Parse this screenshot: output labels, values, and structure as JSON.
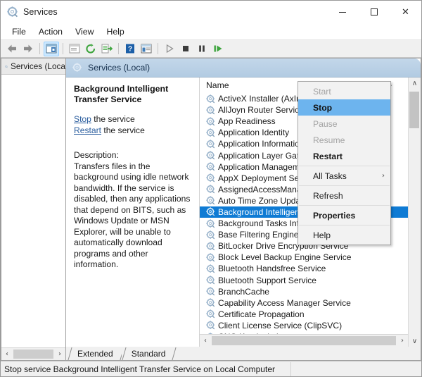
{
  "window": {
    "title": "Services",
    "icon": "services-gear-icon",
    "controls": {
      "minimize": "–",
      "maximize": "□",
      "close": "✕"
    }
  },
  "menubar": {
    "items": [
      "File",
      "Action",
      "View",
      "Help"
    ]
  },
  "toolbar": {
    "buttons": [
      {
        "name": "back-icon",
        "glyph": "back"
      },
      {
        "name": "forward-icon",
        "glyph": "forward"
      },
      {
        "name": "separator",
        "glyph": "sep"
      },
      {
        "name": "show-hide-console-tree-icon",
        "glyph": "tree",
        "active": true
      },
      {
        "name": "separator",
        "glyph": "sep"
      },
      {
        "name": "show-hide-action-pane-icon",
        "glyph": "pane"
      },
      {
        "name": "refresh-icon",
        "glyph": "refresh"
      },
      {
        "name": "export-list-icon",
        "glyph": "export"
      },
      {
        "name": "separator",
        "glyph": "sep"
      },
      {
        "name": "help-icon",
        "glyph": "help"
      },
      {
        "name": "show-hide-details-icon",
        "glyph": "details"
      },
      {
        "name": "separator",
        "glyph": "sep"
      },
      {
        "name": "start-service-icon",
        "glyph": "play"
      },
      {
        "name": "stop-service-icon",
        "glyph": "stop"
      },
      {
        "name": "pause-service-icon",
        "glyph": "pause"
      },
      {
        "name": "restart-service-icon",
        "glyph": "restart"
      }
    ]
  },
  "tree_pane": {
    "root_label": "Services (Loca"
  },
  "content_header": {
    "label": "Services (Local)"
  },
  "detail": {
    "service_title": "Background Intelligent Transfer Service",
    "stop_link": "Stop",
    "stop_suffix": " the service",
    "restart_link": "Restart",
    "restart_suffix": " the service",
    "description_label": "Description:",
    "description": "Transfers files in the background using idle network bandwidth. If the service is disabled, then any applications that depend on BITS, such as Windows Update or MSN Explorer, will be unable to automatically download programs and other information."
  },
  "list": {
    "column_header": "Name",
    "sort_indicator": "∧",
    "rows": [
      {
        "label": "ActiveX Installer (AxInstSV)",
        "selected": false
      },
      {
        "label": "AllJoyn Router Service",
        "selected": false
      },
      {
        "label": "App Readiness",
        "selected": false
      },
      {
        "label": "Application Identity",
        "selected": false
      },
      {
        "label": "Application Information",
        "selected": false
      },
      {
        "label": "Application Layer Gateway Service",
        "selected": false
      },
      {
        "label": "Application Management",
        "selected": false
      },
      {
        "label": "AppX Deployment Service (AppXSVC)",
        "selected": false
      },
      {
        "label": "AssignedAccessManager Service",
        "selected": false
      },
      {
        "label": "Auto Time Zone Updater",
        "selected": false
      },
      {
        "label": "Background Intelligent Transfer Service",
        "selected": true
      },
      {
        "label": "Background Tasks Infrastructure Service",
        "selected": false
      },
      {
        "label": "Base Filtering Engine",
        "selected": false
      },
      {
        "label": "BitLocker Drive Encryption Service",
        "selected": false
      },
      {
        "label": "Block Level Backup Engine Service",
        "selected": false
      },
      {
        "label": "Bluetooth Handsfree Service",
        "selected": false
      },
      {
        "label": "Bluetooth Support Service",
        "selected": false
      },
      {
        "label": "BranchCache",
        "selected": false
      },
      {
        "label": "Capability Access Manager Service",
        "selected": false
      },
      {
        "label": "Certificate Propagation",
        "selected": false
      },
      {
        "label": "Client License Service (ClipSVC)",
        "selected": false
      },
      {
        "label": "CNG Key Isolation",
        "selected": false
      }
    ]
  },
  "context_menu": {
    "items": [
      {
        "label": "Start",
        "state": "disabled",
        "type": "item"
      },
      {
        "label": "Stop",
        "state": "highlight",
        "type": "item"
      },
      {
        "label": "Pause",
        "state": "disabled",
        "type": "item"
      },
      {
        "label": "Resume",
        "state": "disabled",
        "type": "item"
      },
      {
        "label": "Restart",
        "state": "bold",
        "type": "item"
      },
      {
        "label": "",
        "state": "",
        "type": "separator"
      },
      {
        "label": "All Tasks",
        "state": "normal",
        "type": "submenu",
        "arrow": "›"
      },
      {
        "label": "",
        "state": "",
        "type": "separator"
      },
      {
        "label": "Refresh",
        "state": "normal",
        "type": "item"
      },
      {
        "label": "",
        "state": "",
        "type": "separator"
      },
      {
        "label": "Properties",
        "state": "bold",
        "type": "item"
      },
      {
        "label": "",
        "state": "",
        "type": "separator"
      },
      {
        "label": "Help",
        "state": "normal",
        "type": "item"
      }
    ]
  },
  "tabs": {
    "items": [
      "Extended",
      "Standard"
    ],
    "active": "Standard"
  },
  "statusbar": {
    "text": "Stop service Background Intelligent Transfer Service on Local Computer"
  },
  "scrollbars": {
    "vertical_up": "∧",
    "vertical_down": "∨",
    "h_left": "‹",
    "h_right": "›"
  },
  "colors": {
    "selection_blue": "#0f7bd4",
    "menu_highlight": "#6db4ee",
    "header_blue": "#b2cbe2",
    "link_blue": "#2a5d9e"
  }
}
